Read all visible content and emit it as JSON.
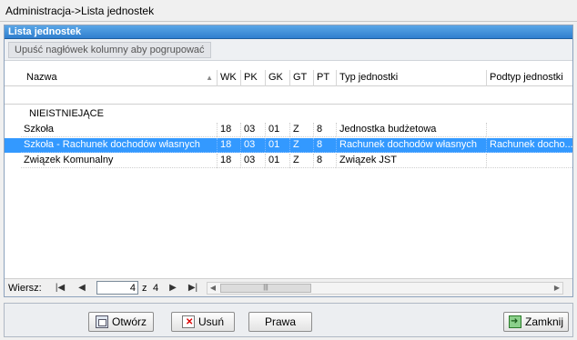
{
  "window": {
    "title": "Administracja->Lista jednostek"
  },
  "panel": {
    "title": "Lista jednostek",
    "group_hint": "Upuść nagłówek kolumny aby pogrupować"
  },
  "columns": [
    "Nazwa",
    "WK",
    "PK",
    "GK",
    "GT",
    "PT",
    "Typ jednostki",
    "Podtyp jednostki"
  ],
  "group": {
    "label": "NIEISTNIEJĄCE"
  },
  "rows": [
    {
      "name": "Szkoła",
      "wk": "18",
      "pk": "03",
      "gk": "01",
      "gt": "Z",
      "pt": "8",
      "typ": "Jednostka budżetowa",
      "podtyp": ""
    },
    {
      "name": "Szkoła - Rachunek dochodów własnych",
      "wk": "18",
      "pk": "03",
      "gk": "01",
      "gt": "Z",
      "pt": "8",
      "typ": "Rachunek dochodów własnych",
      "podtyp": "Rachunek docho..."
    },
    {
      "name": "Związek Komunalny",
      "wk": "18",
      "pk": "03",
      "gk": "01",
      "gt": "Z",
      "pt": "8",
      "typ": "Związek JST",
      "podtyp": ""
    }
  ],
  "selected_row": 1,
  "navigator": {
    "label": "Wiersz:",
    "current": "4",
    "of_label": "z",
    "total": "4"
  },
  "buttons": {
    "open": "Otwórz",
    "delete": "Usuń",
    "rights": "Prawa",
    "close": "Zamknij"
  },
  "colors": {
    "selection": "#3399ff",
    "header": "#2f7fcf"
  }
}
